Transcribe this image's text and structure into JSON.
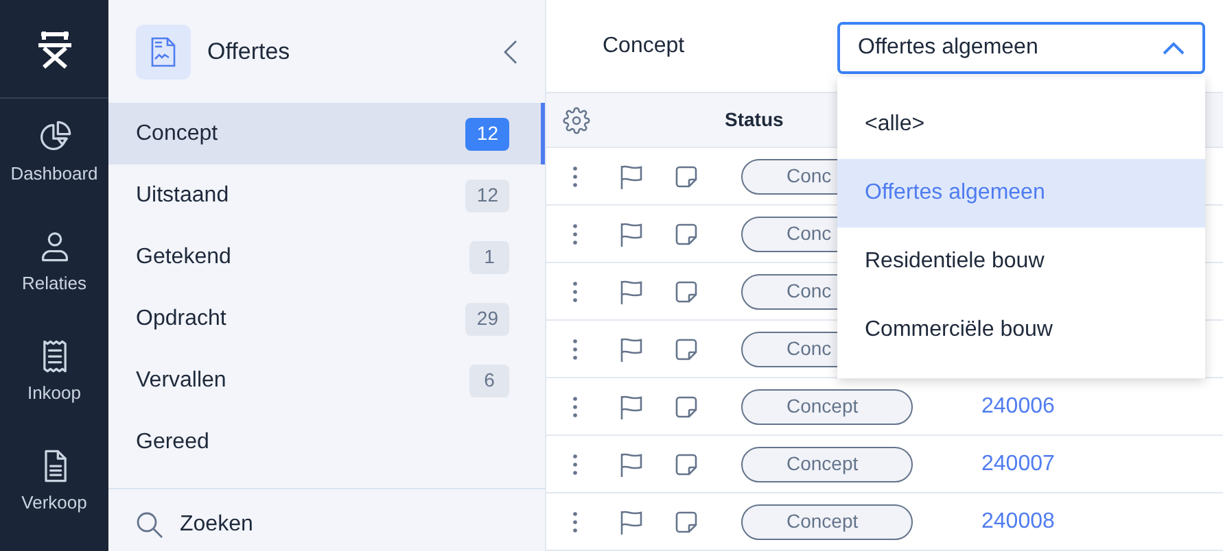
{
  "nav": [
    {
      "label": "Dashboard"
    },
    {
      "label": "Relaties"
    },
    {
      "label": "Inkoop"
    },
    {
      "label": "Verkoop"
    }
  ],
  "sidebar": {
    "title": "Offertes",
    "items": [
      {
        "label": "Concept",
        "count": "12",
        "selected": true
      },
      {
        "label": "Uitstaand",
        "count": "12",
        "selected": false
      },
      {
        "label": "Getekend",
        "count": "1",
        "selected": false
      },
      {
        "label": "Opdracht",
        "count": "29",
        "selected": false
      },
      {
        "label": "Vervallen",
        "count": "6",
        "selected": false
      },
      {
        "label": "Gereed",
        "selected": false
      }
    ],
    "search": "Zoeken"
  },
  "toolbar": {
    "title": "Concept",
    "select": {
      "value": "Offertes algemeen",
      "expanded": true,
      "options": [
        {
          "label": "<alle>",
          "selected": false
        },
        {
          "label": "Offertes algemeen",
          "selected": true
        },
        {
          "label": "Residentiele bouw",
          "selected": false
        },
        {
          "label": "Commerciële bouw",
          "selected": false
        }
      ]
    }
  },
  "table": {
    "columns": [
      "Status"
    ],
    "rows": [
      {
        "status": "Conc"
      },
      {
        "status": "Conc"
      },
      {
        "status": "Conc"
      },
      {
        "status": "Conc"
      },
      {
        "status": "Concept",
        "number": "240006"
      },
      {
        "status": "Concept",
        "number": "240007"
      },
      {
        "status": "Concept",
        "number": "240008"
      }
    ]
  }
}
